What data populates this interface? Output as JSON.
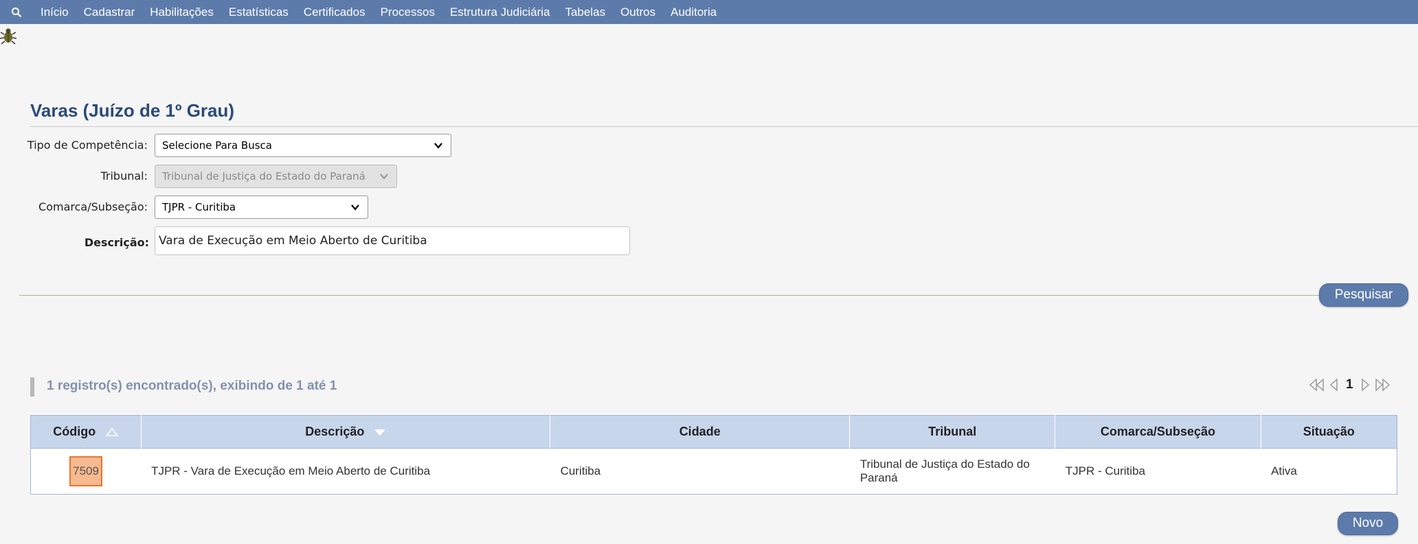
{
  "menu": {
    "items": [
      "Início",
      "Cadastrar",
      "Habilitações",
      "Estatísticas",
      "Certificados",
      "Processos",
      "Estrutura Judiciária",
      "Tabelas",
      "Outros",
      "Auditoria"
    ]
  },
  "page": {
    "title": "Varas (Juízo de 1º Grau)"
  },
  "form": {
    "tipo_label": "Tipo de Competência:",
    "tipo_value": "Selecione Para Busca",
    "tribunal_label": "Tribunal:",
    "tribunal_value": "Tribunal de Justiça do Estado do Paraná",
    "comarca_label": "Comarca/Subseção:",
    "comarca_value": "TJPR - Curitiba",
    "descricao_label": "Descrição:",
    "descricao_value": "Vara de Execução em Meio Aberto de Curitiba",
    "search_button": "Pesquisar"
  },
  "results": {
    "count_text": "1 registro(s) encontrado(s), exibindo de 1 até 1",
    "page": "1",
    "columns": [
      "Código",
      "Descrição",
      "Cidade",
      "Tribunal",
      "Comarca/Subseção",
      "Situação"
    ],
    "rows": [
      {
        "codigo": "7509",
        "descricao": "TJPR - Vara de Execução em Meio Aberto de Curitiba",
        "cidade": "Curitiba",
        "tribunal": "Tribunal de Justiça do Estado do Paraná",
        "comarca": "TJPR - Curitiba",
        "situacao": "Ativa"
      }
    ]
  },
  "actions": {
    "new_button": "Novo"
  },
  "colors": {
    "nav": "#5c7bab",
    "header": "#c8d6ec",
    "highlight": "#f7b98f",
    "title": "#2b4a78"
  }
}
